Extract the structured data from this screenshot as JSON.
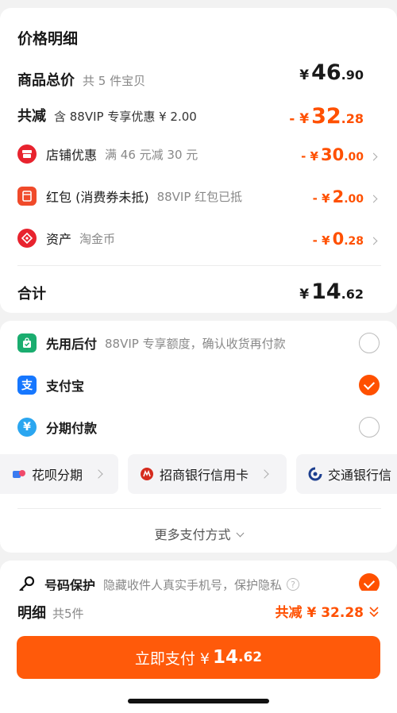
{
  "price_detail": {
    "title": "价格明细",
    "goods_total": {
      "label": "商品总价",
      "desc": "共 5 件宝贝",
      "yen": "¥",
      "int": "46",
      "dec": ".90"
    },
    "total_reduce": {
      "label": "共减",
      "desc": "含 88VIP 专享优惠 ¥ 2.00",
      "yen": "- ¥",
      "int": "32",
      "dec": ".28"
    },
    "items": [
      {
        "name": "店铺优惠",
        "desc": "满 46 元减 30 元",
        "yen": "- ¥",
        "int": "30",
        "dec": ".00",
        "icon": "shop-icon"
      },
      {
        "name": "红包 (消费券未抵)",
        "desc": "88VIP 红包已抵",
        "yen": "- ¥",
        "int": "2",
        "dec": ".00",
        "icon": "red-packet-icon"
      },
      {
        "name": "资产",
        "desc": "淘金币",
        "yen": "- ¥",
        "int": "0",
        "dec": ".28",
        "icon": "coin-tag-icon"
      }
    ],
    "sum": {
      "label": "合计",
      "yen": "¥",
      "int": "14",
      "dec": ".62"
    }
  },
  "payment": {
    "methods": [
      {
        "name": "先用后付",
        "desc": "88VIP 专享额度，确认收货再付款",
        "selected": false,
        "icon": "bag-check-icon"
      },
      {
        "name": "支付宝",
        "desc": "",
        "selected": true,
        "icon": "alipay-icon"
      },
      {
        "name": "分期付款",
        "desc": "",
        "selected": false,
        "icon": "installment-icon"
      }
    ],
    "chips": [
      {
        "label": "花呗分期",
        "icon": "huabei-icon"
      },
      {
        "label": "招商银行信用卡",
        "icon": "cmb-icon"
      },
      {
        "label": "交通银行信",
        "icon": "bocom-icon"
      }
    ],
    "more": "更多支付方式"
  },
  "privacy": {
    "label": "号码保护",
    "desc": "隐藏收件人真实手机号，保护隐私",
    "selected": true
  },
  "footer": {
    "detail_label": "明细",
    "detail_count": "共5件",
    "reduce_text": "共减 ¥ 32.28",
    "pay_prefix": "立即支付 ¥",
    "pay_int": "14",
    "pay_dec": ".62"
  },
  "colors": {
    "accent": "#ff5000",
    "button": "#ff5a0a",
    "alipay": "#1677ff",
    "green": "#1aad6f"
  }
}
